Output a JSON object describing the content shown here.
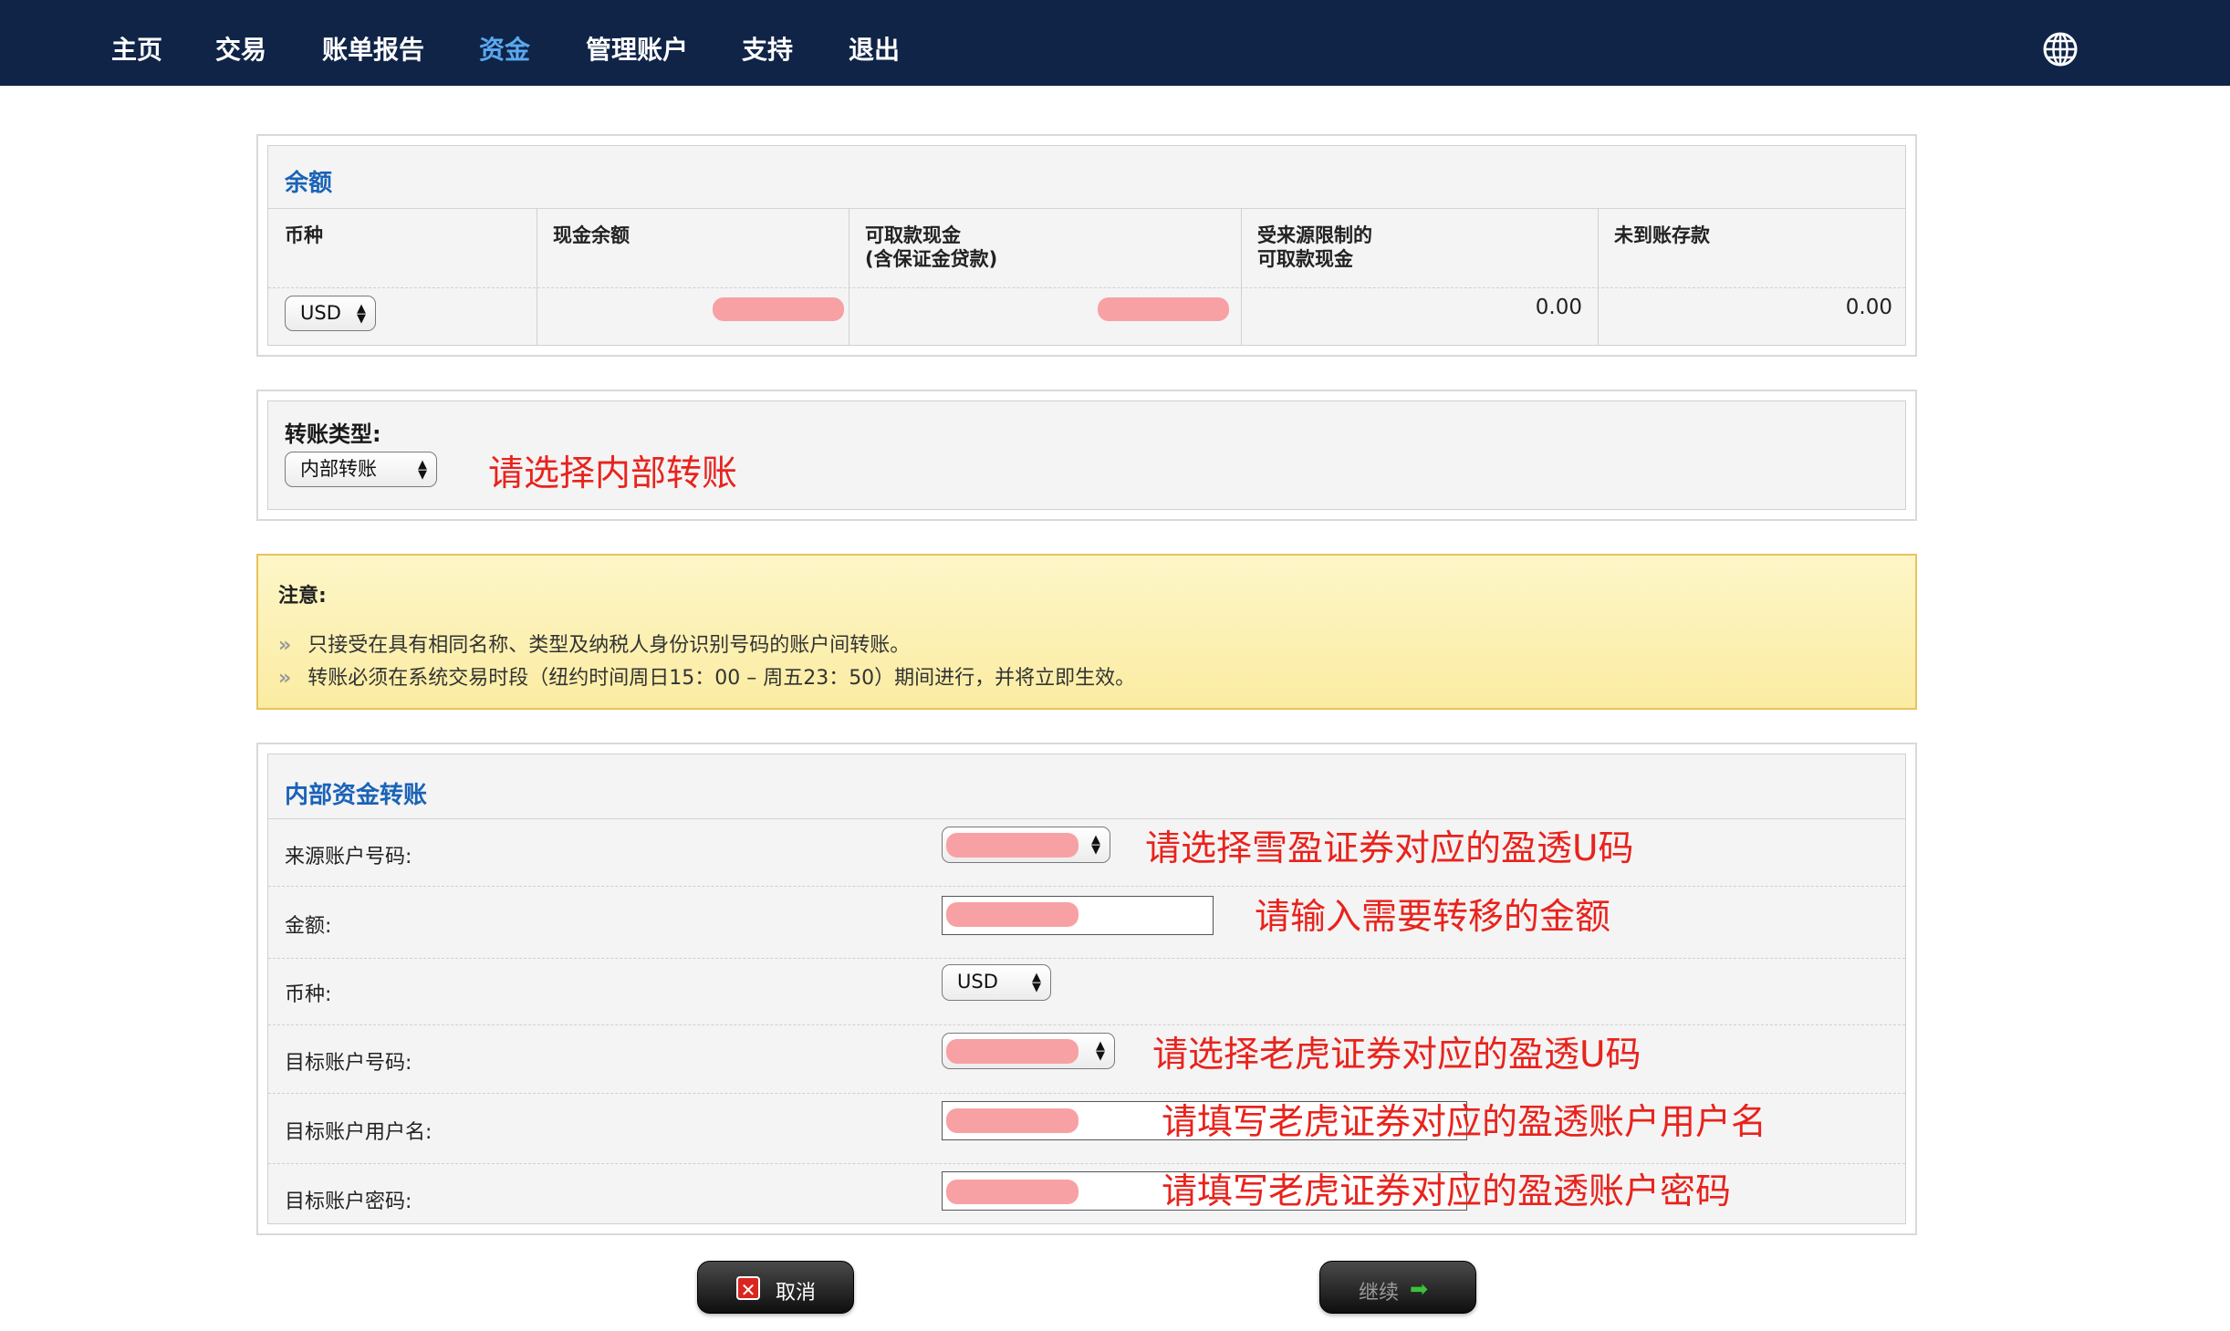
{
  "nav": {
    "items": [
      "主页",
      "交易",
      "账单报告",
      "资金",
      "管理账户",
      "支持",
      "退出"
    ],
    "active_index": 3
  },
  "balance": {
    "title": "余额",
    "headers": [
      "币种",
      "现金余额",
      "可取款现金\n(含保证金贷款)",
      "受来源限制的\n可取款现金",
      "未到账存款"
    ],
    "currency": "USD",
    "restricted_cash": "0.00",
    "pending_deposits": "0.00"
  },
  "transfer_type": {
    "label": "转账类型:",
    "selected": "内部转账",
    "annotation": "请选择内部转账"
  },
  "notice": {
    "title": "注意:",
    "lines": [
      "只接受在具有相同名称、类型及纳税人身份识别号码的账户间转账。",
      "转账必须在系统交易时段（纽约时间周日15：00 – 周五23：50）期间进行，并将立即生效。"
    ],
    "bullet": "»"
  },
  "internal": {
    "title": "内部资金转账",
    "rows": [
      {
        "label": "来源账户号码:",
        "annotation": "请选择雪盈证券对应的盈透U码"
      },
      {
        "label": "金额:",
        "annotation": "请输入需要转移的金额"
      },
      {
        "label": "币种:",
        "value": "USD"
      },
      {
        "label": "目标账户号码:",
        "annotation": "请选择老虎证券对应的盈透U码"
      },
      {
        "label": "目标账户用户名:",
        "annotation": "请填写老虎证券对应的盈透账户用户名"
      },
      {
        "label": "目标账户密码:",
        "annotation": "请填写老虎证券对应的盈透账户密码"
      }
    ]
  },
  "buttons": {
    "cancel": "取消",
    "continue": "继续"
  },
  "colors": {
    "nav_bg": "#0f2447",
    "nav_active": "#5aa9f0",
    "title_blue": "#1a63b7",
    "annotation_red": "#e8231d",
    "redaction": "#f7a1a4"
  }
}
